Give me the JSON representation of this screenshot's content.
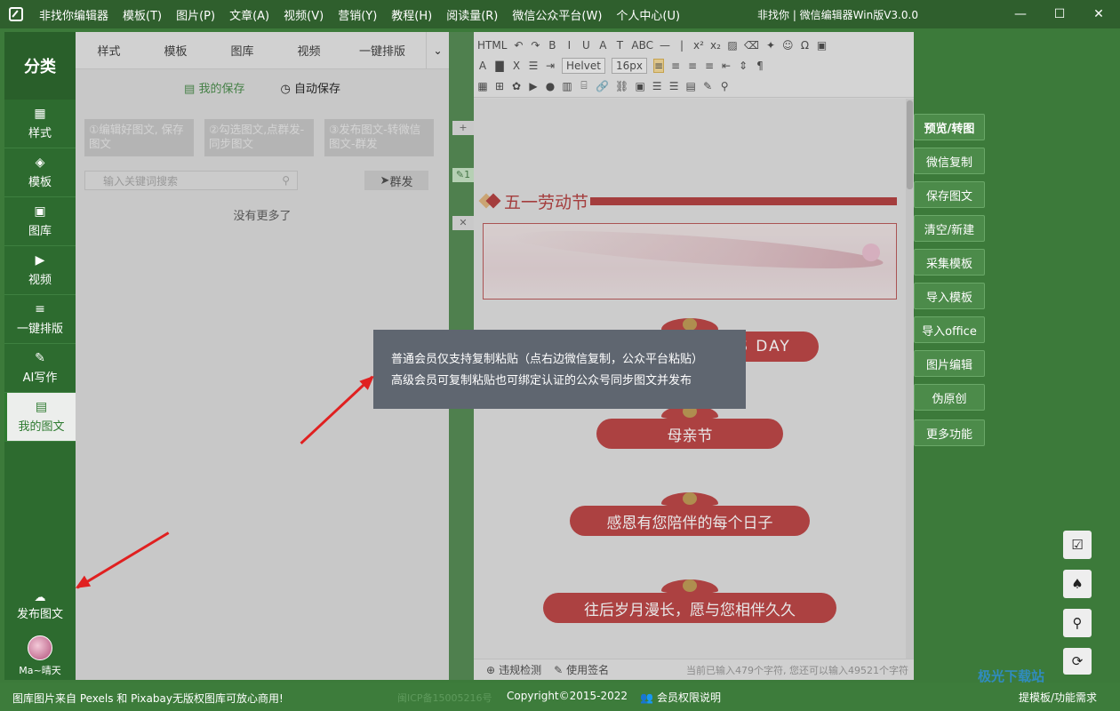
{
  "window": {
    "menu": [
      "非找你编辑器",
      "模板(T)",
      "图片(P)",
      "文章(A)",
      "视频(V)",
      "营销(Y)",
      "教程(H)",
      "阅读量(R)",
      "微信公众平台(W)",
      "个人中心(U)"
    ],
    "title": "非找你 | 微信编辑器Win版V3.0.0",
    "min": "—",
    "max": "☐",
    "close": "✕"
  },
  "sidebar": {
    "header": "分类",
    "items": [
      {
        "label": "样式",
        "icon": "▦"
      },
      {
        "label": "模板",
        "icon": "◈"
      },
      {
        "label": "图库",
        "icon": "▣"
      },
      {
        "label": "视频",
        "icon": "▶"
      },
      {
        "label": "一键排版",
        "icon": "≡"
      },
      {
        "label": "AI写作",
        "icon": "✎"
      },
      {
        "label": "我的图文",
        "icon": "▤"
      }
    ],
    "publish": {
      "label": "发布图文",
      "icon": "☁"
    },
    "user": "Ma~晴天"
  },
  "panel": {
    "tabs": [
      "样式",
      "模板",
      "图库",
      "视频",
      "一键排版"
    ],
    "more": "⌄",
    "subtabs": [
      "我的保存",
      "自动保存"
    ],
    "steps": [
      "①编辑好图文, 保存图文",
      "②勾选图文,点群发-同步图文",
      "③发布图文-转微信图文-群发"
    ],
    "search_placeholder": "输入关键词搜索",
    "mass_send": "群发",
    "empty": "没有更多了"
  },
  "gutter": {
    "add": "+",
    "edit": "1",
    "close": "✕"
  },
  "toolbar": {
    "row1": [
      "HTML",
      "↶",
      "↷",
      "B",
      "I",
      "U",
      "A",
      "T",
      "ABC",
      "—",
      "|",
      "x²",
      "x₂",
      "▨",
      "⌫",
      "✦",
      "☺",
      "Ω",
      "▣"
    ],
    "row2_font": "Helvet",
    "row2_size": "16px",
    "row2": [
      "A",
      "▇",
      "X",
      "☰",
      "⇥"
    ],
    "row3": [
      "▦",
      "⊞",
      "✿",
      "▶",
      "●",
      "▥",
      "⌸",
      "🔗",
      "⛓",
      "▣",
      "☰",
      "☰",
      "▤",
      "✎",
      "⚲"
    ]
  },
  "doc": {
    "section_title": "五一劳动节",
    "pills": [
      "HAPPY MOTHER\"S DAY",
      "母亲节",
      "感恩有您陪伴的每个日子",
      "往后岁月漫长，愿与您相伴久久"
    ]
  },
  "status": {
    "check": "违规检测",
    "sign": "使用签名",
    "count": "当前已输入479个字符, 您还可以输入49521个字符"
  },
  "right_buttons": [
    "预览/转图",
    "微信复制",
    "保存图文",
    "清空/新建",
    "采集模板",
    "导入模板",
    "导入office",
    "图片编辑",
    "伪原创",
    "更多功能"
  ],
  "right_icons": [
    "calendar-check-icon",
    "qq-icon",
    "search-icon",
    "refresh-icon"
  ],
  "tooltip": {
    "line1": "普通会员仅支持复制粘贴（点右边微信复制，公众平台粘贴）",
    "line2": "高级会员可复制粘贴也可绑定认证的公众号同步图文并发布"
  },
  "footer": {
    "left": "图库图片来自 Pexels 和 Pixabay无版权图库可放心商用!",
    "icp": "闽ICP备15005216号",
    "copyright": "Copyright©2015-2022",
    "rights": "会员权限说明",
    "request": "提模板/功能需求"
  },
  "watermark": "极光下载站",
  "colors": {
    "brand_green": "#3c7a3a",
    "accent_red": "#a82525",
    "tooltip_bg": "#5f6670"
  }
}
